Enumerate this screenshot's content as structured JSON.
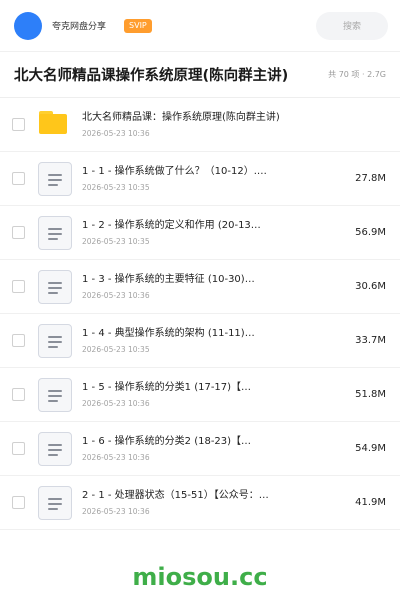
{
  "header": {
    "user_name": "夸克网盘分享",
    "badge": "SVIP",
    "search_placeholder": "搜索"
  },
  "share": {
    "title": "北大名师精品课操作系统原理(陈向群主讲)",
    "summary": "共 70 项 · 2.7G"
  },
  "files": [
    {
      "type": "folder",
      "name": "北大名师精品课：操作系统原理(陈向群主讲)",
      "date": "2026-05-23 10:36",
      "size": ""
    },
    {
      "type": "doc",
      "name": "1 - 1 - 操作系统做了什么？（10-12）.…",
      "date": "2026-05-23 10:35",
      "size": "27.8M"
    },
    {
      "type": "doc",
      "name": "1 - 2 - 操作系统的定义和作用 (20-13…",
      "date": "2026-05-23 10:35",
      "size": "56.9M"
    },
    {
      "type": "doc",
      "name": "1 - 3 - 操作系统的主要特征 (10-30)…",
      "date": "2026-05-23 10:36",
      "size": "30.6M"
    },
    {
      "type": "doc",
      "name": "1 - 4 - 典型操作系统的架构 (11-11)…",
      "date": "2026-05-23 10:35",
      "size": "33.7M"
    },
    {
      "type": "doc",
      "name": "1 - 5 - 操作系统的分类1 (17-17)【…",
      "date": "2026-05-23 10:36",
      "size": "51.8M"
    },
    {
      "type": "doc",
      "name": "1 - 6 - 操作系统的分类2 (18-23)【…",
      "date": "2026-05-23 10:36",
      "size": "54.9M"
    },
    {
      "type": "doc",
      "name": "2 - 1 - 处理器状态（15-51）【公众号：…",
      "date": "2026-05-23 10:36",
      "size": "41.9M"
    }
  ],
  "watermark": "miosou.cc"
}
